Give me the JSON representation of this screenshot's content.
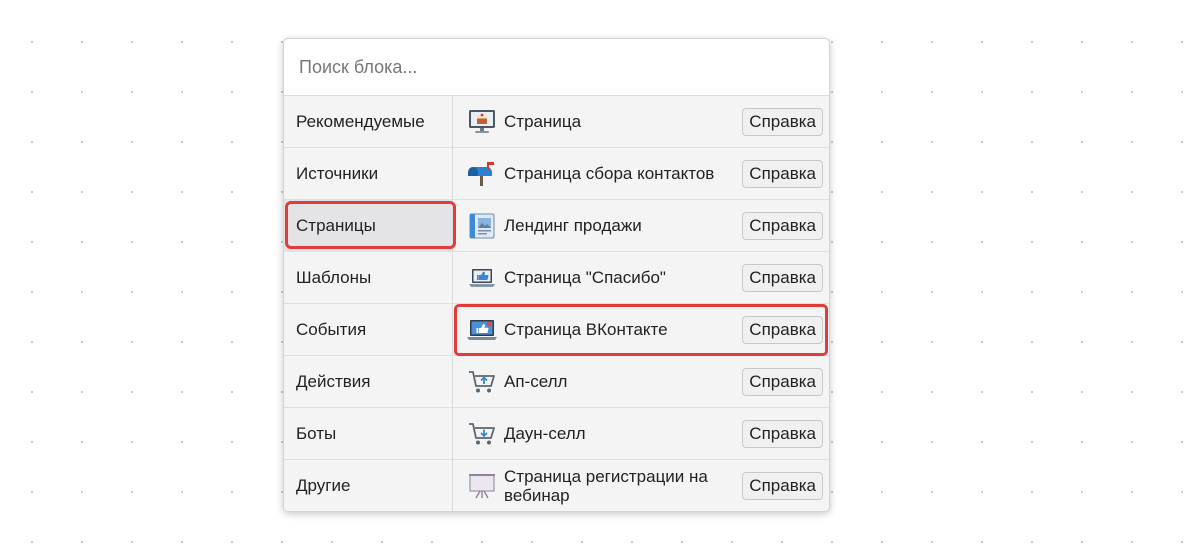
{
  "search": {
    "placeholder": "Поиск блока..."
  },
  "categories": [
    {
      "label": "Рекомендуемые",
      "selected": false
    },
    {
      "label": "Источники",
      "selected": false
    },
    {
      "label": "Страницы",
      "selected": true
    },
    {
      "label": "Шаблоны",
      "selected": false
    },
    {
      "label": "События",
      "selected": false
    },
    {
      "label": "Действия",
      "selected": false
    },
    {
      "label": "Боты",
      "selected": false
    },
    {
      "label": "Другие",
      "selected": false
    }
  ],
  "items": [
    {
      "label": "Страница",
      "icon": "monitor-cake-icon",
      "help": "Справка",
      "highlighted": false
    },
    {
      "label": "Страница сбора контактов",
      "icon": "mailbox-icon",
      "help": "Справка",
      "highlighted": false
    },
    {
      "label": "Лендинг продажи",
      "icon": "landing-page-icon",
      "help": "Справка",
      "highlighted": false
    },
    {
      "label": "Страница \"Спасибо\"",
      "icon": "laptop-thumbs-up-icon",
      "help": "Справка",
      "highlighted": false
    },
    {
      "label": "Страница ВКонтакте",
      "icon": "laptop-like-icon",
      "help": "Справка",
      "highlighted": true
    },
    {
      "label": "Ап-селл",
      "icon": "cart-up-icon",
      "help": "Справка",
      "highlighted": false
    },
    {
      "label": "Даун-селл",
      "icon": "cart-down-icon",
      "help": "Справка",
      "highlighted": false
    },
    {
      "label": "Страница регистрации на вебинар",
      "icon": "presentation-board-icon",
      "help": "Справка",
      "highlighted": false
    }
  ],
  "colors": {
    "highlight": "#e03c3c",
    "panel_bg": "#f4f4f5",
    "selected_bg": "#e4e4e6"
  }
}
